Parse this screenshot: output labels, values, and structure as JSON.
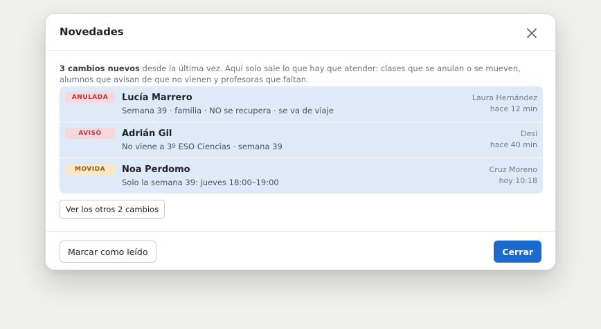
{
  "dialog": {
    "title": "Novedades",
    "close_icon": "close-icon",
    "intro_bold": "3 cambios nuevos",
    "intro_text": " desde la última vez. Aquí solo sale lo que hay que atender: clases que se anulan o se mueven, alumnos que avisan de que no vienen y profesoras que faltan."
  },
  "changes": [
    {
      "badge": "ANULADA",
      "badge_color": "#b4363f",
      "name": "Lucía Marrero",
      "detail": "Semana 39 · familia · NO se recupera · se va de viaje",
      "author": "Laura Hernández",
      "time": "hace 12 min"
    },
    {
      "badge": "AVISÓ",
      "badge_color": "#b4363f",
      "name": "Adrián Gil",
      "detail": "No viene a 3º ESO Ciencias · semana 39",
      "author": "Desi",
      "time": "hace 40 min"
    },
    {
      "badge": "MOVIDA",
      "badge_color": "#93601a",
      "name": "Noa Perdomo",
      "detail": "Solo la semana 39: jueves 18:00–19:00",
      "author": "Cruz Moreno",
      "time": "hoy 10:18"
    }
  ],
  "actions": {
    "more_label": "Ver los otros 2 cambios",
    "mark_read_label": "Marcar como leído",
    "close_label": "Cerrar"
  },
  "colors": {
    "primary": "#1b6ad0",
    "row_highlight": "#dfeaf8"
  }
}
